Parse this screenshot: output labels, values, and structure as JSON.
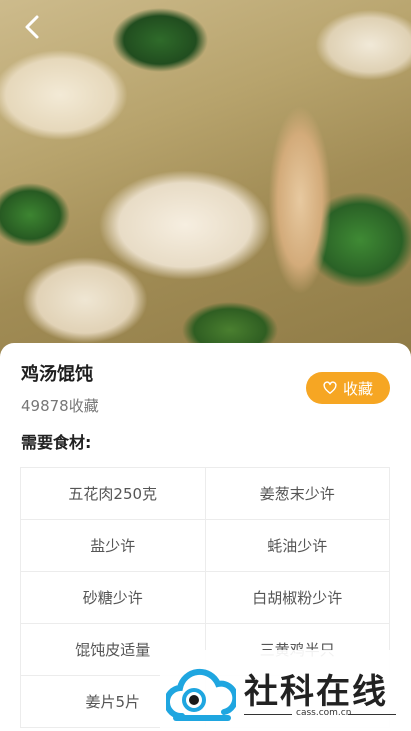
{
  "recipe": {
    "title": "鸡汤馄饨",
    "favorites_count": "49878收藏",
    "favorite_button_label": "收藏",
    "ingredients_heading": "需要食材:",
    "ingredients": [
      [
        "五花肉250克",
        "姜葱末少许"
      ],
      [
        "盐少许",
        "蚝油少许"
      ],
      [
        "砂糖少许",
        "白胡椒粉少许"
      ],
      [
        "馄饨皮适量",
        "三黄鸡半只"
      ],
      [
        "姜片5片",
        ""
      ]
    ]
  },
  "watermark": {
    "brand": "社科在线",
    "url": "cass.com.cn"
  },
  "colors": {
    "accent": "#f6a623",
    "logo_blue": "#1fa6e0"
  },
  "icons": {
    "back": "chevron-left-icon",
    "favorite": "heart-outline-icon"
  }
}
